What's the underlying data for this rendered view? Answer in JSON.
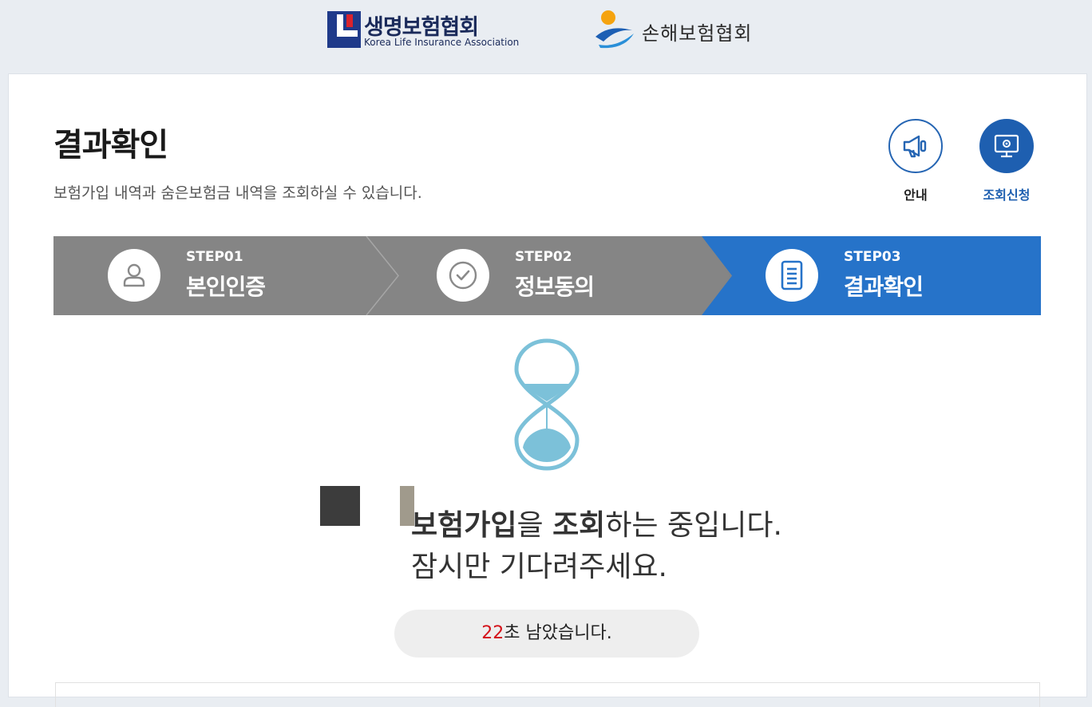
{
  "header": {
    "klia": {
      "name_ko": "생명보험협회",
      "name_en": "Korea Life Insurance Association"
    },
    "gia": {
      "name_ko": "손해보험협회"
    }
  },
  "page": {
    "title": "결과확인",
    "subtitle": "보험가입 내역과 숨은보험금 내역을 조회하실 수 있습니다."
  },
  "quick_links": [
    {
      "label": "안내",
      "icon": "megaphone-icon"
    },
    {
      "label": "조회신청",
      "icon": "monitor-settings-icon"
    }
  ],
  "steps": [
    {
      "num": "STEP01",
      "name": "본인인증",
      "icon": "user-icon",
      "active": false
    },
    {
      "num": "STEP02",
      "name": "정보동의",
      "icon": "check-circle-icon",
      "active": false
    },
    {
      "num": "STEP03",
      "name": "결과확인",
      "icon": "document-icon",
      "active": true
    }
  ],
  "loading": {
    "line1_bold1": "보험가입",
    "line1_mid": "을 ",
    "line1_bold2": "조회",
    "line1_rest": "하는 중입니다.",
    "line2": "잠시만 기다려주세요."
  },
  "timer": {
    "seconds": "22",
    "suffix": "초 남았습니다."
  },
  "colors": {
    "step_inactive": "#858585",
    "step_active": "#2673c9",
    "accent": "#1e5fb0",
    "timer_num": "#d4121a"
  }
}
